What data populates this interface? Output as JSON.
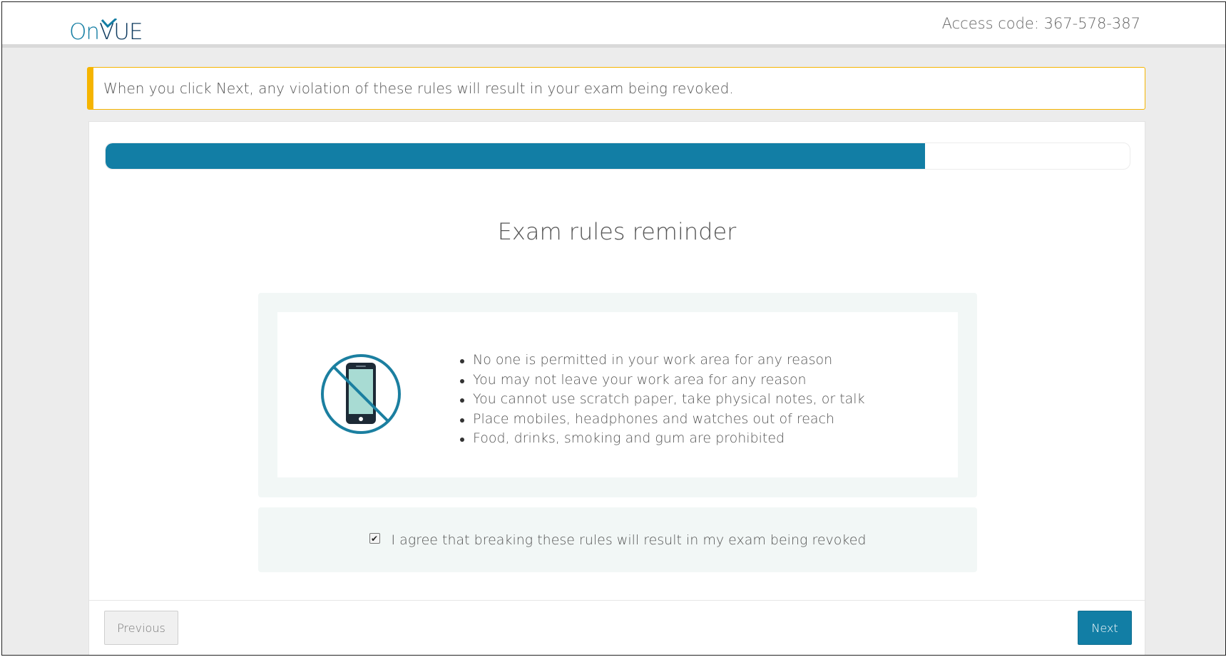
{
  "header": {
    "logo_on": "On",
    "logo_v": "V",
    "logo_ue": "UE",
    "access_code": "Access code: 367-578-387"
  },
  "warning": {
    "text": "When you click Next, any violation of these rules will result in your exam being revoked.",
    "color": "#f5b400"
  },
  "progress": {
    "percent": 80,
    "color": "#127ea5"
  },
  "page_title": "Exam rules reminder",
  "rules": {
    "icon": "no-phone-icon",
    "items": [
      "No one is permitted in your work area for any reason",
      "You may not leave your work area for any reason",
      "You cannot use scratch paper, take physical notes, or talk",
      "Place mobiles, headphones and watches out of reach",
      "Food, drinks, smoking and gum are prohibited"
    ]
  },
  "agreement": {
    "checked": true,
    "label": "I agree that breaking these rules will result in my exam being revoked"
  },
  "footer": {
    "previous_label": "Previous",
    "next_label": "Next"
  }
}
